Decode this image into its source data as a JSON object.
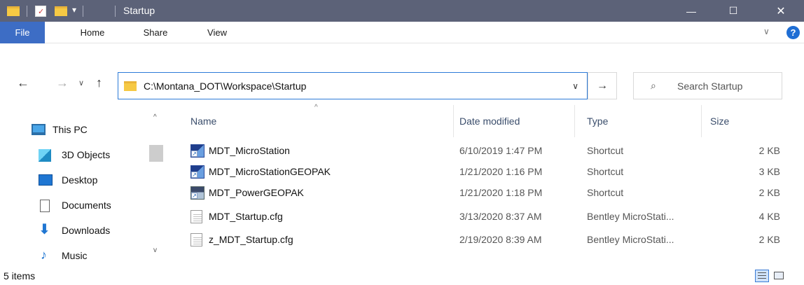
{
  "window": {
    "title": "Startup",
    "minimize_glyph": "—",
    "maximize_glyph": "☐",
    "close_glyph": "✕",
    "qat_dropdown_glyph": "▾"
  },
  "ribbon": {
    "tabs": [
      {
        "label": "File"
      },
      {
        "label": "Home"
      },
      {
        "label": "Share"
      },
      {
        "label": "View"
      }
    ],
    "expand_glyph": "∨",
    "help_glyph": "?"
  },
  "nav": {
    "back_glyph": "←",
    "forward_glyph": "→",
    "recent_glyph": "∨",
    "up_glyph": "↑",
    "address": "C:\\Montana_DOT\\Workspace\\Startup",
    "address_dropdown_glyph": "∨",
    "go_glyph": "→",
    "search_placeholder": "Search Startup"
  },
  "sidebar": {
    "items": [
      {
        "label": "This PC",
        "icon": "pc-icon"
      },
      {
        "label": "3D Objects",
        "icon": "3d-objects-icon"
      },
      {
        "label": "Desktop",
        "icon": "desktop-icon"
      },
      {
        "label": "Documents",
        "icon": "documents-icon"
      },
      {
        "label": "Downloads",
        "icon": "downloads-icon"
      },
      {
        "label": "Music",
        "icon": "music-icon"
      }
    ],
    "scroll_up_glyph": "^",
    "scroll_down_glyph": "v"
  },
  "columns": {
    "name": "Name",
    "date": "Date modified",
    "type": "Type",
    "size": "Size",
    "sort_glyph": "^"
  },
  "files": [
    {
      "name": "MDT_MicroStation",
      "date": "6/10/2019 1:47 PM",
      "type": "Shortcut",
      "size": "2 KB",
      "icon": "microstation-shortcut-icon"
    },
    {
      "name": "MDT_MicroStationGEOPAK",
      "date": "1/21/2020 1:16 PM",
      "type": "Shortcut",
      "size": "3 KB",
      "icon": "microstation-shortcut-icon"
    },
    {
      "name": "MDT_PowerGEOPAK",
      "date": "1/21/2020 1:18 PM",
      "type": "Shortcut",
      "size": "2 KB",
      "icon": "powergeopak-shortcut-icon"
    },
    {
      "name": "MDT_Startup.cfg",
      "date": "3/13/2020 8:37 AM",
      "type": "Bentley MicroStati...",
      "size": "4 KB",
      "icon": "text-file-icon"
    },
    {
      "name": "z_MDT_Startup.cfg",
      "date": "2/19/2020 8:39 AM",
      "type": "Bentley MicroStati...",
      "size": "2 KB",
      "icon": "text-file-icon"
    }
  ],
  "status": {
    "item_count": "5 items"
  },
  "colors": {
    "titlebar": "#5c6278",
    "file_tab": "#3d6dc5",
    "accent": "#2d7bd8"
  }
}
